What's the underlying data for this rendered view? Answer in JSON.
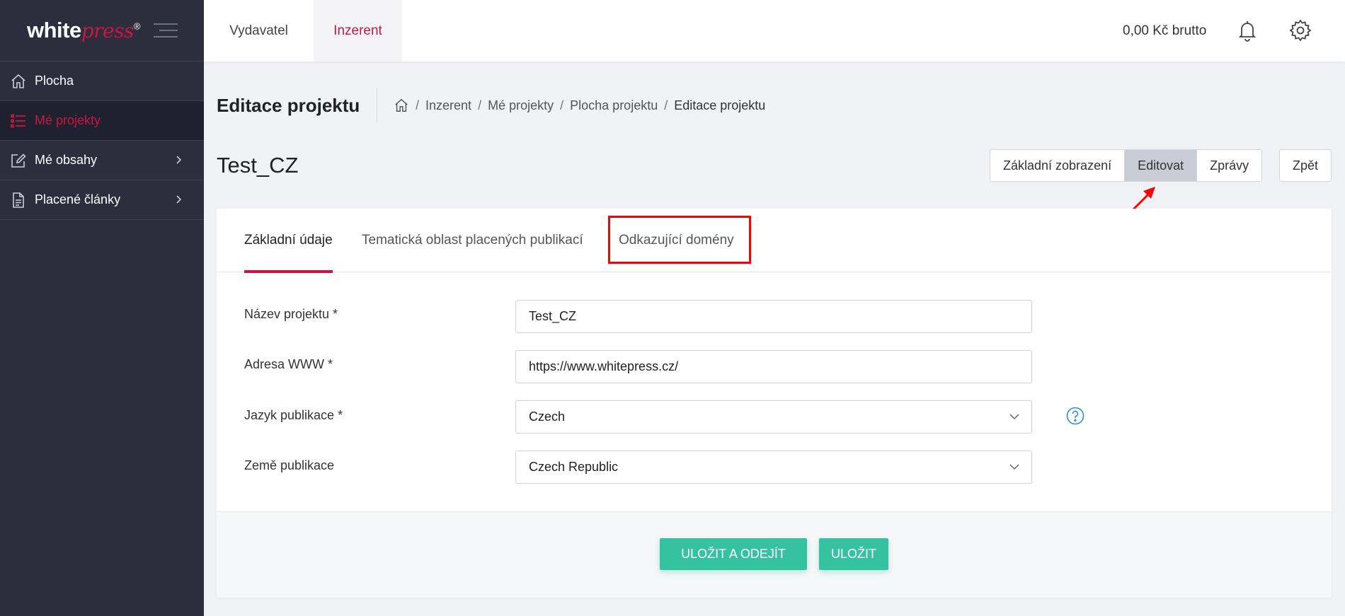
{
  "brand": {
    "name_white": "white",
    "name_press": "press",
    "mark": "®"
  },
  "sidebar": {
    "items": [
      {
        "label": "Plocha",
        "icon": "home-icon"
      },
      {
        "label": "Mé projekty",
        "icon": "list-icon",
        "active": true
      },
      {
        "label": "Mé obsahy",
        "icon": "edit-icon",
        "has_submenu": true
      },
      {
        "label": "Placené články",
        "icon": "document-icon",
        "has_submenu": true
      }
    ]
  },
  "topbar": {
    "roles": [
      "Vydavatel",
      "Inzerent"
    ],
    "active_role": "Inzerent",
    "balance": "0,00 Kč brutto",
    "icons": [
      "bell-icon",
      "gear-icon"
    ]
  },
  "page": {
    "title": "Editace projektu",
    "breadcrumb": [
      "Inzerent",
      "Mé projekty",
      "Plocha projektu",
      "Editace projektu"
    ],
    "project_name": "Test_CZ"
  },
  "view_buttons": {
    "items": [
      "Základní zobrazení",
      "Editovat",
      "Zprávy"
    ],
    "active": "Editovat",
    "back": "Zpět"
  },
  "tabs": {
    "items": [
      "Základní údaje",
      "Tematická oblast placených publikací",
      "Odkazující domény"
    ],
    "active": "Základní údaje"
  },
  "form": {
    "project_name": {
      "label": "Název projektu *",
      "value": "Test_CZ"
    },
    "website": {
      "label": "Adresa WWW *",
      "value": "https://www.whitepress.cz/"
    },
    "language": {
      "label": "Jazyk publikace *",
      "value": "Czech"
    },
    "country": {
      "label": "Země publikace",
      "value": "Czech Republic"
    }
  },
  "actions": {
    "save_exit": "ULOŽIT A ODEJÍT",
    "save": "ULOŽIT"
  },
  "colors": {
    "accent": "#c8173f",
    "sidebar": "#2c2e3d",
    "green": "#35c2a1",
    "annotation": "#ff0000"
  }
}
